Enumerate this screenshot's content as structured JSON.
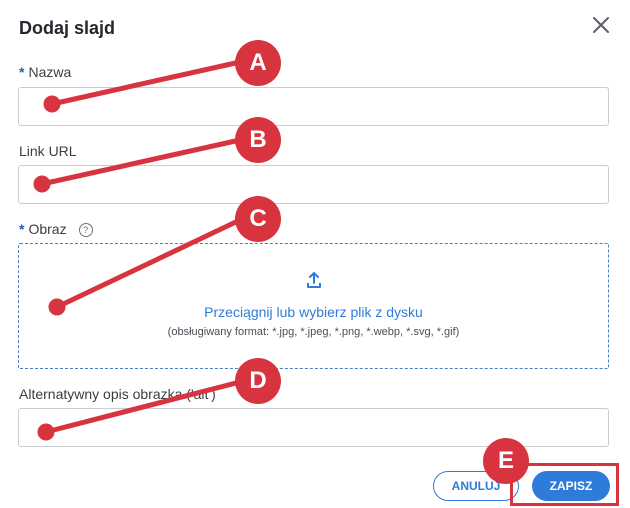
{
  "dialog": {
    "title": "Dodaj slajd",
    "close_icon": "close-icon"
  },
  "fields": {
    "name": {
      "required_mark": "*",
      "label": "Nazwa",
      "value": "",
      "placeholder": ""
    },
    "link": {
      "label": "Link URL",
      "value": "",
      "placeholder": ""
    },
    "image": {
      "required_mark": "*",
      "label": "Obraz",
      "help_icon": "question-circle-icon",
      "help_glyph": "?",
      "upload_icon": "upload-icon",
      "drop_text": "Przeciągnij lub wybierz plik z dysku",
      "formats_text": "(obsługiwany format: *.jpg, *.jpeg, *.png, *.webp, *.svg, *.gif)"
    },
    "alt": {
      "label": "Alternatywny opis obrazka ('alt')",
      "value": "",
      "placeholder": ""
    }
  },
  "buttons": {
    "cancel": "ANULUJ",
    "save": "ZAPISZ"
  },
  "annotations": {
    "markers": [
      "A",
      "B",
      "C",
      "D",
      "E"
    ],
    "color": "#d8343f"
  },
  "colors": {
    "accent": "#2f7bd9",
    "required": "#1a5fb4",
    "annotation": "#d8343f"
  }
}
